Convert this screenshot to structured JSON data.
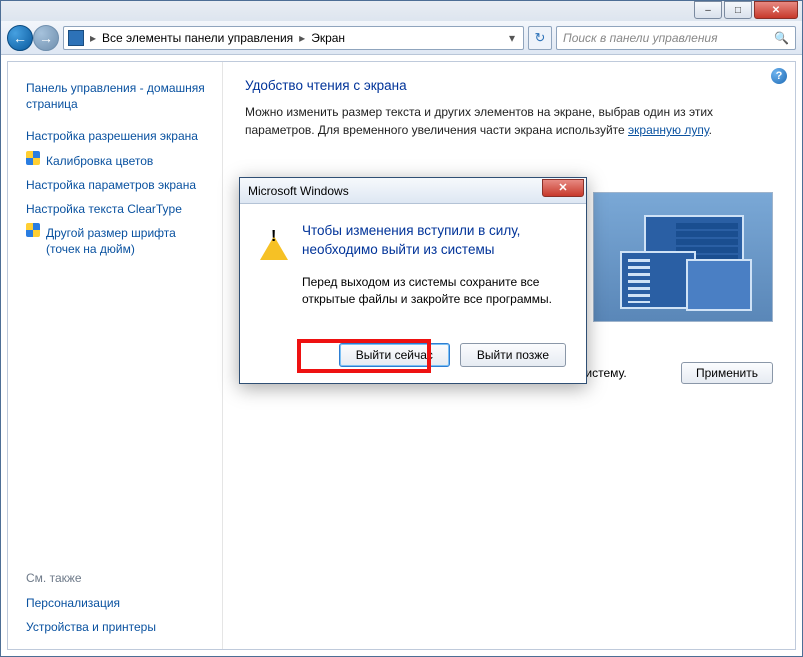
{
  "titlebar": {
    "minimize_glyph": "–",
    "maximize_glyph": "□",
    "close_glyph": "✕"
  },
  "nav": {
    "back_glyph": "←",
    "forward_glyph": "→",
    "refresh_glyph": "↻",
    "dropdown_glyph": "▾",
    "search_glyph": "🔍"
  },
  "breadcrumb": {
    "level1": "Все элементы панели управления",
    "level2": "Экран",
    "separator": "▸"
  },
  "search": {
    "placeholder": "Поиск в панели управления"
  },
  "sidebar": {
    "home": "Панель управления - домашняя страница",
    "items": [
      "Настройка разрешения экрана",
      "Калибровка цветов",
      "Настройка параметров экрана",
      "Настройка текста ClearType",
      "Другой размер шрифта (точек на дюйм)"
    ],
    "see_also_label": "См. также",
    "see_also": [
      "Персонализация",
      "Устройства и принтеры"
    ]
  },
  "main": {
    "title": "Удобство чтения с экрана",
    "intro_part1": "Можно изменить размер текста и других элементов на экране, выбрав один из этих параметров. Для временного увеличения части экрана используйте ",
    "intro_link": "экранную лупу",
    "intro_part2": ".",
    "footer_warning": "Это изменение вступит в силу при следующем входе в систему.",
    "apply_button": "Применить"
  },
  "dialog": {
    "title": "Microsoft Windows",
    "heading": "Чтобы изменения вступили в силу, необходимо выйти из системы",
    "body": "Перед выходом из системы сохраните все открытые файлы и закройте все программы.",
    "button_primary": "Выйти сейчас",
    "button_secondary": "Выйти позже",
    "close_glyph": "✕"
  },
  "help_glyph": "?"
}
